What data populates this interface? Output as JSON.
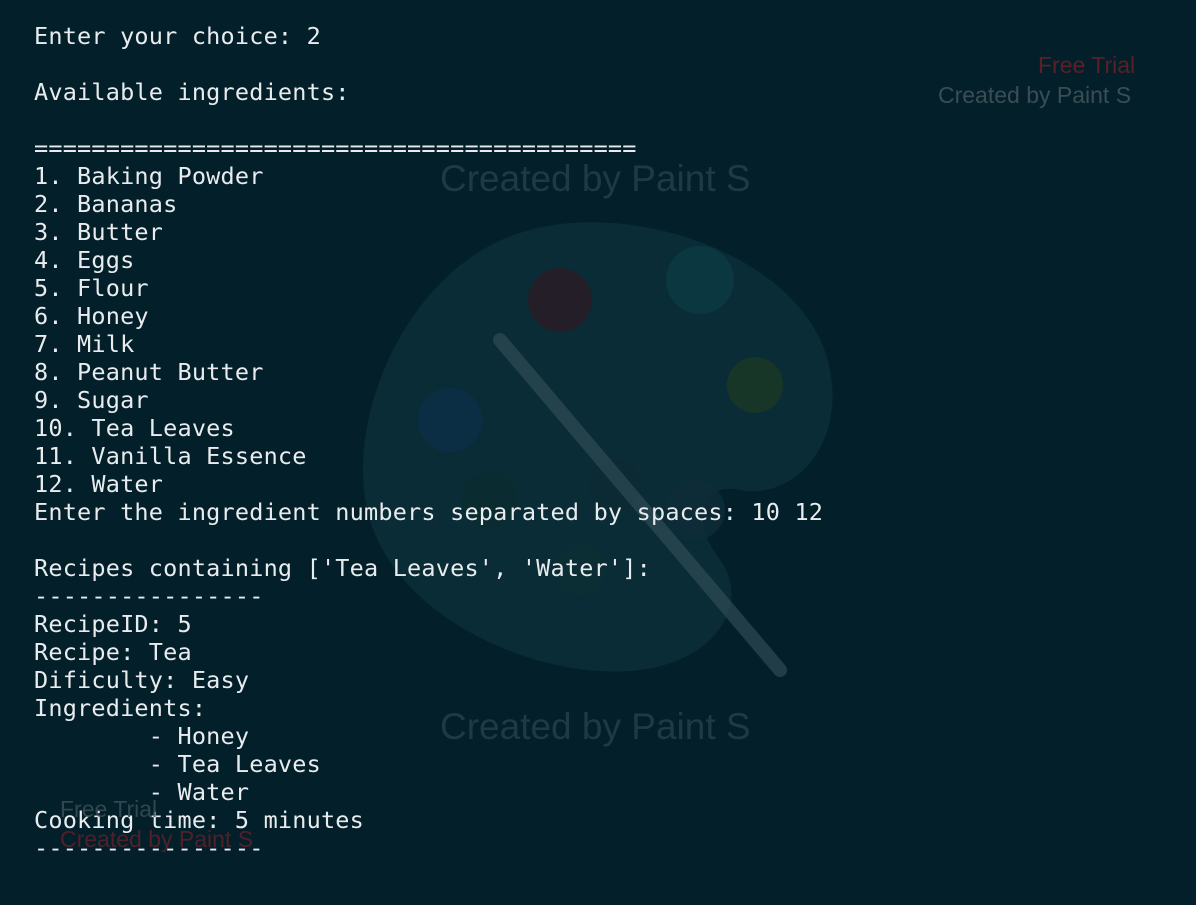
{
  "terminal": {
    "lines": [
      "Enter your choice: 2",
      "",
      "Available ingredients:",
      "",
      "==========================================",
      "1. Baking Powder",
      "2. Bananas",
      "3. Butter",
      "4. Eggs",
      "5. Flour",
      "6. Honey",
      "7. Milk",
      "8. Peanut Butter",
      "9. Sugar",
      "10. Tea Leaves",
      "11. Vanilla Essence",
      "12. Water",
      "Enter the ingredient numbers separated by spaces: 10 12",
      "",
      "Recipes containing ['Tea Leaves', 'Water']:",
      "----------------",
      "RecipeID: 5",
      "Recipe: Tea",
      "Dificulty: Easy",
      "Ingredients:",
      "        - Honey",
      "        - Tea Leaves",
      "        - Water",
      "Cooking time: 5 minutes",
      "----------------"
    ]
  },
  "watermark": {
    "free_trial_top": "Free Trial",
    "created_by_top": "Created by Paint S",
    "created_by_center_top": "Created by Paint S",
    "created_by_center_bottom": "Created by Paint S",
    "free_trial_bottom": "Free Trial",
    "created_by_bottom": "Created by Paint S"
  },
  "colors": {
    "background": "#03202a",
    "text": "#e9ecee",
    "watermark_red": "#5a1f27",
    "watermark_grey": "#3a4d55"
  }
}
